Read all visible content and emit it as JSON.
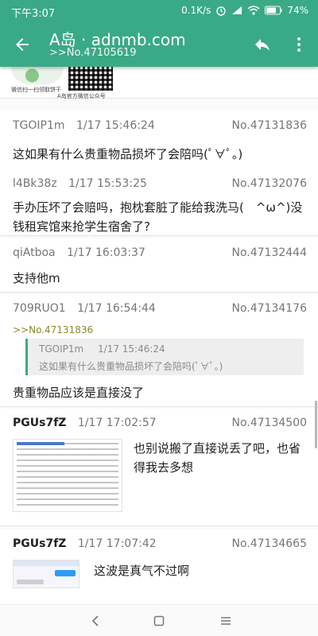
{
  "status_bar": {
    "time": "下午3:07",
    "network_speed": "0.1K/s",
    "battery": "74%",
    "icons": [
      "alarm-icon",
      "signal-icon",
      "wifi-icon",
      "battery-icon"
    ]
  },
  "toolbar": {
    "title": "A岛 · adnmb.com",
    "subtitle": ">>No.47105619",
    "icons": [
      "back-arrow-icon",
      "reply-icon",
      "more-vert-icon"
    ]
  },
  "qr_strip": {
    "left_caption": "微信扫一扫领取饼干",
    "right_caption": "A岛官方微信公众号"
  },
  "posts": [
    {
      "uid": "TGOIP1m",
      "time": "1/17 15:46:24",
      "no": "No.47131836",
      "content": "这如果有什么贵重物品损坏了会陪吗(ﾟ∀ﾟ。)"
    },
    {
      "uid": "l4Bk38z",
      "time": "1/17 15:53:25",
      "no": "No.47132076",
      "content": "手办压坏了会赔吗，抱枕套脏了能给我洗马(　^ω^)没钱租宾馆来抢学生宿舍了?"
    },
    {
      "uid": "qiAtboa",
      "time": "1/17 16:03:37",
      "no": "No.47132444",
      "content": "支持他m"
    },
    {
      "uid": "709RUO1",
      "time": "1/17 16:54:44",
      "no": "No.47134176",
      "quote_link": ">>No.47131836",
      "quote": {
        "uid": "TGOIP1m",
        "time": "1/17 15:46:24",
        "content": "这如果有什么贵重物品损坏了会陪吗(ﾟ∀ﾟ。)"
      },
      "content": "贵重物品应该是直接没了"
    },
    {
      "uid": "PGUs7fZ",
      "time": "1/17 17:02:57",
      "no": "No.47134500",
      "content": "也别说搬了直接说丢了吧，也省得我去多想"
    },
    {
      "uid": "PGUs7fZ",
      "time": "1/17 17:07:42",
      "no": "No.47134665",
      "content": "这波是真气不过啊"
    }
  ],
  "colors": {
    "accent": "#3aaa86",
    "background": "#fafafa",
    "quote_link": "#8a8a2a"
  },
  "nav_bar": {
    "icons": [
      "nav-back-icon",
      "nav-home-icon",
      "nav-menu-icon"
    ]
  }
}
